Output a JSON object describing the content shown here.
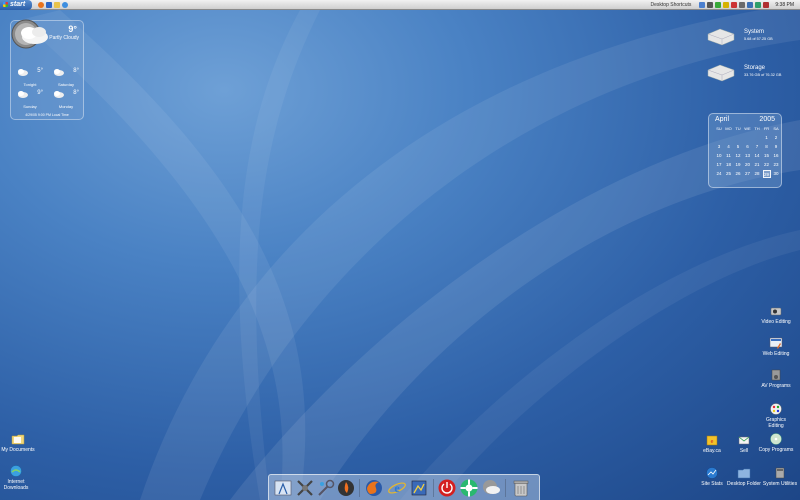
{
  "taskbar": {
    "start_label": "start",
    "shortcuts_label": "Desktop Shortcuts",
    "clock": "9:38 PM",
    "quicklaunch_icons": [
      "firefox-icon",
      "outlook-icon",
      "folder-icon",
      "ie-icon"
    ],
    "tray_icons": [
      "network-icon",
      "volume-icon",
      "messenger-icon",
      "antivirus-icon",
      "update-icon",
      "printer-icon",
      "battery-icon",
      "chat-icon",
      "security-icon"
    ]
  },
  "weather": {
    "current_temp": "9°",
    "current_condition": "Partly Cloudy",
    "forecast": [
      {
        "day": "Tonight",
        "temp": "5°"
      },
      {
        "day": "Saturday",
        "temp": "8°"
      },
      {
        "day": "Sunday",
        "temp": "9°"
      },
      {
        "day": "Monday",
        "temp": "8°"
      }
    ],
    "timestamp": "4/29/05 9:00 PM Local Time"
  },
  "drives": [
    {
      "name": "System",
      "size": "5.68 of 57.25 GB"
    },
    {
      "name": "Storage",
      "size": "33.76 GB of 76.32 GB"
    }
  ],
  "calendar": {
    "month": "April",
    "year": "2005",
    "weekdays": [
      "SU",
      "MO",
      "TU",
      "WE",
      "TH",
      "FR",
      "SA"
    ],
    "rows": [
      [
        "",
        "",
        "",
        "",
        "",
        "1",
        "2"
      ],
      [
        "3",
        "4",
        "5",
        "6",
        "7",
        "8",
        "9"
      ],
      [
        "10",
        "11",
        "12",
        "13",
        "14",
        "15",
        "16"
      ],
      [
        "17",
        "18",
        "19",
        "20",
        "21",
        "22",
        "23"
      ],
      [
        "24",
        "25",
        "26",
        "27",
        "28",
        "29",
        "30"
      ]
    ],
    "today": "29"
  },
  "desktop_icons": {
    "my_documents": "My Documents",
    "internet_downloads": "Internet Downloads",
    "video_editing": "Video Editing",
    "web_editing": "Web Editing",
    "av_programs": "AV Programs",
    "graphics_editing": "Graphics Editing",
    "copy_programs": "Copy Programs",
    "ebay": "eBay.ca",
    "sell": "Sell",
    "site_stats": "Site Stats",
    "desktop_folder": "Desktop Folder",
    "system_utilities": "System Utilities"
  },
  "dock": {
    "icons": [
      "finder-icon",
      "x-tools-icon",
      "utilities-icon",
      "burn-icon",
      "firefox-icon",
      "ie-icon",
      "photo-icon",
      "power-icon",
      "lifesaver-icon",
      "weather-icon",
      "trash-icon"
    ]
  },
  "colors": {
    "wallpaper": "#3a6fb5",
    "taskbar": "#e4e4e4",
    "start_button": "#3f74bd"
  }
}
